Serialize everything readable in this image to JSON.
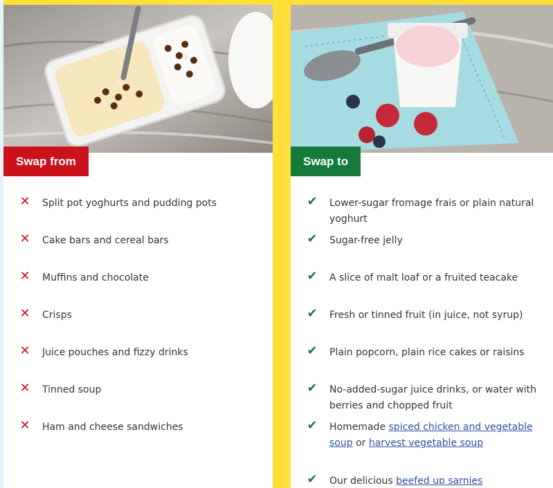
{
  "swap_from": {
    "heading": "Swap from",
    "items": [
      {
        "text": "Split pot yoghurts and pudding pots"
      },
      {
        "text": "Cake bars and cereal bars"
      },
      {
        "text": "Muffins and chocolate"
      },
      {
        "text": "Crisps"
      },
      {
        "text": "Juice pouches and fizzy drinks"
      },
      {
        "text": "Tinned soup"
      },
      {
        "text": "Ham and cheese sandwiches"
      }
    ]
  },
  "swap_to": {
    "heading": "Swap to",
    "items": [
      {
        "text": "Lower-sugar fromage frais or plain natural yoghurt"
      },
      {
        "text": "Sugar-free jelly"
      },
      {
        "text": "A slice of malt loaf or a fruited teacake"
      },
      {
        "text": "Fresh or tinned fruit (in juice, not syrup)"
      },
      {
        "text": "Plain popcorn, plain rice cakes or raisins"
      },
      {
        "text": "No-added-sugar juice drinks, or water with berries and chopped fruit"
      },
      {
        "prefix": "Homemade ",
        "link1": "spiced chicken and vegetable soup",
        "middle": " or ",
        "link2": "harvest vegetable soup"
      },
      {
        "prefix": "Our delicious ",
        "link1": "beefed up sarnies"
      }
    ]
  },
  "colors": {
    "background_yellow": "#ffe03a",
    "swap_from_red": "#c9121b",
    "swap_to_green": "#177a3b",
    "link_blue": "#2d4fa0"
  },
  "icons": {
    "cross": "cross-icon",
    "check": "check-icon"
  }
}
